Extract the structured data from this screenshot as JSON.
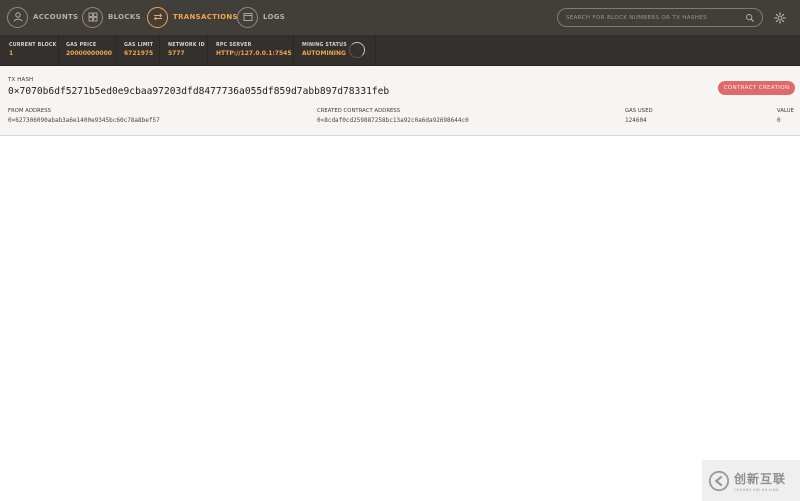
{
  "nav": {
    "items": [
      {
        "label": "ACCOUNTS",
        "icon": "account-icon"
      },
      {
        "label": "BLOCKS",
        "icon": "blocks-icon"
      },
      {
        "label": "TRANSACTIONS",
        "icon": "transactions-icon",
        "active": true
      },
      {
        "label": "LOGS",
        "icon": "logs-icon"
      }
    ],
    "search_placeholder": "SEARCH FOR BLOCK NUMBERS OR TX HASHES",
    "settings_icon": "gear-icon"
  },
  "status": {
    "current_block": {
      "label": "CURRENT BLOCK",
      "value": "1"
    },
    "gas_price": {
      "label": "GAS PRICE",
      "value": "20000000000"
    },
    "gas_limit": {
      "label": "GAS LIMIT",
      "value": "6721975"
    },
    "network_id": {
      "label": "NETWORK ID",
      "value": "5777"
    },
    "rpc_server": {
      "label": "RPC SERVER",
      "value": "HTTP://127.0.0.1:7545"
    },
    "mining_status": {
      "label": "MINING STATUS",
      "value": "AUTOMINING"
    }
  },
  "transaction": {
    "hash_label": "TX HASH",
    "hash": "0×7070b6df5271b5ed0e9cbaa97203dfd8477736a055df859d7abb897d78331feb",
    "badge": "CONTRACT CREATION",
    "from_label": "FROM ADDRESS",
    "from": "0×627306090abab3a6e1400e9345bc60c78a8bef57",
    "created_label": "CREATED CONTRACT ADDRESS",
    "created": "0×8cdaf0cd259887258bc13a92c0a6da92698644c0",
    "gas_used_label": "GAS USED",
    "gas_used": "124604",
    "value_label": "VALUE",
    "value": "0"
  },
  "watermark": {
    "cn": "创新互联",
    "en": "CHUANG XIN HU LIAN"
  },
  "colors": {
    "nav_bg": "#423e3a",
    "status_bg": "#34302d",
    "accent": "#f0a64c",
    "badge": "#e06a69"
  }
}
